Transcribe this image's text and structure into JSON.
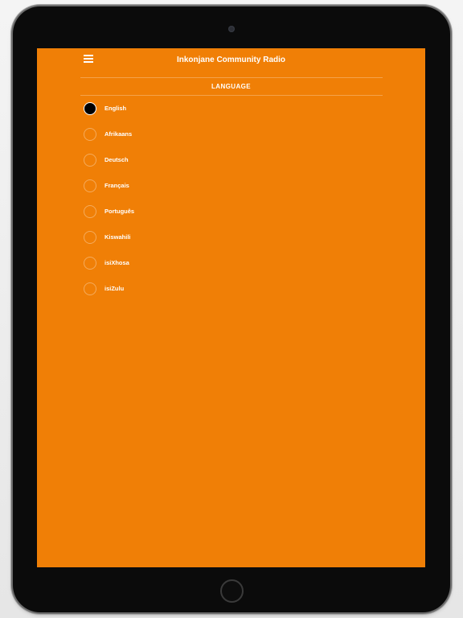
{
  "app": {
    "title": "Inkonjane Community Radio"
  },
  "header": {
    "menu_icon": "hamburger-menu-icon"
  },
  "section": {
    "title": "LANGUAGE"
  },
  "languages": [
    {
      "label": "English",
      "selected": true
    },
    {
      "label": "Afrikaans",
      "selected": false
    },
    {
      "label": "Deutsch",
      "selected": false
    },
    {
      "label": "Français",
      "selected": false
    },
    {
      "label": "Português",
      "selected": false
    },
    {
      "label": "Kiswahili",
      "selected": false
    },
    {
      "label": "isiXhosa",
      "selected": false
    },
    {
      "label": "isiZulu",
      "selected": false
    }
  ],
  "colors": {
    "background": "#f07f06",
    "text": "#ffffff",
    "selected_radio": "#000000",
    "device_frame": "#0b0b0b"
  }
}
